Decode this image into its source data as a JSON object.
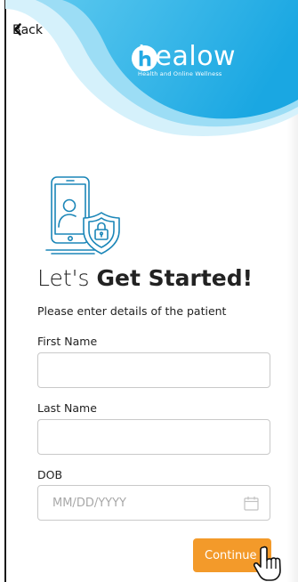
{
  "header": {
    "back_label": "Back",
    "logo": {
      "name": "healow",
      "tagline": "Health and Online Wellness"
    }
  },
  "intro": {
    "title_light": "Let's",
    "title_bold": "Get Started!",
    "subtitle": "Please enter details of the patient"
  },
  "form": {
    "first_name": {
      "label": "First Name",
      "value": "",
      "placeholder": ""
    },
    "last_name": {
      "label": "Last Name",
      "value": "",
      "placeholder": ""
    },
    "dob": {
      "label": "DOB",
      "value": "",
      "placeholder": "MM/DD/YYYY"
    }
  },
  "actions": {
    "continue_label": "Continue"
  },
  "colors": {
    "header_blue": "#2ab0e6",
    "header_light": "#cdeffa",
    "accent_orange": "#f39a2a",
    "illustration_blue": "#1b86b8"
  },
  "icons": [
    "chevron-left-icon",
    "healow-logo-icon",
    "phone-shield-lock-illustration",
    "calendar-icon",
    "hand-pointer-icon"
  ]
}
